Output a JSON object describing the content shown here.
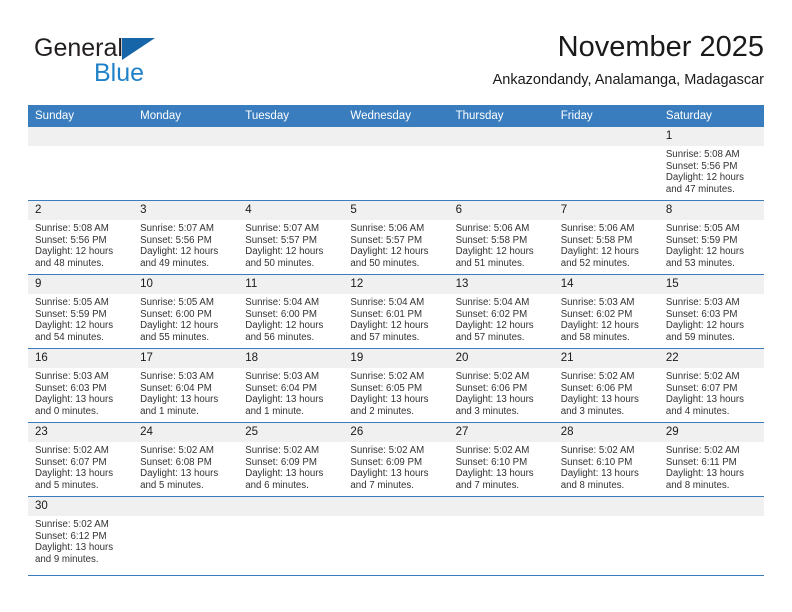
{
  "brand": {
    "name_top": "General",
    "name_bottom": "Blue",
    "color_black": "#231f20",
    "color_blue": "#1f82c8",
    "triangle_color": "#1565a8"
  },
  "header": {
    "title": "November 2025",
    "subtitle": "Ankazondandy, Analamanga, Madagascar"
  },
  "theme": {
    "header_bg": "#3a7dbf",
    "header_text": "#ffffff",
    "daynum_bg": "#f0f0f0",
    "row_line": "#3a7dbf"
  },
  "weekdays": [
    "Sunday",
    "Monday",
    "Tuesday",
    "Wednesday",
    "Thursday",
    "Friday",
    "Saturday"
  ],
  "weeks": [
    [
      {
        "day": "",
        "empty": true
      },
      {
        "day": "",
        "empty": true
      },
      {
        "day": "",
        "empty": true
      },
      {
        "day": "",
        "empty": true
      },
      {
        "day": "",
        "empty": true
      },
      {
        "day": "",
        "empty": true
      },
      {
        "day": "1",
        "sunrise": "Sunrise: 5:08 AM",
        "sunset": "Sunset: 5:56 PM",
        "daylight": "Daylight: 12 hours and 47 minutes."
      }
    ],
    [
      {
        "day": "2",
        "sunrise": "Sunrise: 5:08 AM",
        "sunset": "Sunset: 5:56 PM",
        "daylight": "Daylight: 12 hours and 48 minutes."
      },
      {
        "day": "3",
        "sunrise": "Sunrise: 5:07 AM",
        "sunset": "Sunset: 5:56 PM",
        "daylight": "Daylight: 12 hours and 49 minutes."
      },
      {
        "day": "4",
        "sunrise": "Sunrise: 5:07 AM",
        "sunset": "Sunset: 5:57 PM",
        "daylight": "Daylight: 12 hours and 50 minutes."
      },
      {
        "day": "5",
        "sunrise": "Sunrise: 5:06 AM",
        "sunset": "Sunset: 5:57 PM",
        "daylight": "Daylight: 12 hours and 50 minutes."
      },
      {
        "day": "6",
        "sunrise": "Sunrise: 5:06 AM",
        "sunset": "Sunset: 5:58 PM",
        "daylight": "Daylight: 12 hours and 51 minutes."
      },
      {
        "day": "7",
        "sunrise": "Sunrise: 5:06 AM",
        "sunset": "Sunset: 5:58 PM",
        "daylight": "Daylight: 12 hours and 52 minutes."
      },
      {
        "day": "8",
        "sunrise": "Sunrise: 5:05 AM",
        "sunset": "Sunset: 5:59 PM",
        "daylight": "Daylight: 12 hours and 53 minutes."
      }
    ],
    [
      {
        "day": "9",
        "sunrise": "Sunrise: 5:05 AM",
        "sunset": "Sunset: 5:59 PM",
        "daylight": "Daylight: 12 hours and 54 minutes."
      },
      {
        "day": "10",
        "sunrise": "Sunrise: 5:05 AM",
        "sunset": "Sunset: 6:00 PM",
        "daylight": "Daylight: 12 hours and 55 minutes."
      },
      {
        "day": "11",
        "sunrise": "Sunrise: 5:04 AM",
        "sunset": "Sunset: 6:00 PM",
        "daylight": "Daylight: 12 hours and 56 minutes."
      },
      {
        "day": "12",
        "sunrise": "Sunrise: 5:04 AM",
        "sunset": "Sunset: 6:01 PM",
        "daylight": "Daylight: 12 hours and 57 minutes."
      },
      {
        "day": "13",
        "sunrise": "Sunrise: 5:04 AM",
        "sunset": "Sunset: 6:02 PM",
        "daylight": "Daylight: 12 hours and 57 minutes."
      },
      {
        "day": "14",
        "sunrise": "Sunrise: 5:03 AM",
        "sunset": "Sunset: 6:02 PM",
        "daylight": "Daylight: 12 hours and 58 minutes."
      },
      {
        "day": "15",
        "sunrise": "Sunrise: 5:03 AM",
        "sunset": "Sunset: 6:03 PM",
        "daylight": "Daylight: 12 hours and 59 minutes."
      }
    ],
    [
      {
        "day": "16",
        "sunrise": "Sunrise: 5:03 AM",
        "sunset": "Sunset: 6:03 PM",
        "daylight": "Daylight: 13 hours and 0 minutes."
      },
      {
        "day": "17",
        "sunrise": "Sunrise: 5:03 AM",
        "sunset": "Sunset: 6:04 PM",
        "daylight": "Daylight: 13 hours and 1 minute."
      },
      {
        "day": "18",
        "sunrise": "Sunrise: 5:03 AM",
        "sunset": "Sunset: 6:04 PM",
        "daylight": "Daylight: 13 hours and 1 minute."
      },
      {
        "day": "19",
        "sunrise": "Sunrise: 5:02 AM",
        "sunset": "Sunset: 6:05 PM",
        "daylight": "Daylight: 13 hours and 2 minutes."
      },
      {
        "day": "20",
        "sunrise": "Sunrise: 5:02 AM",
        "sunset": "Sunset: 6:06 PM",
        "daylight": "Daylight: 13 hours and 3 minutes."
      },
      {
        "day": "21",
        "sunrise": "Sunrise: 5:02 AM",
        "sunset": "Sunset: 6:06 PM",
        "daylight": "Daylight: 13 hours and 3 minutes."
      },
      {
        "day": "22",
        "sunrise": "Sunrise: 5:02 AM",
        "sunset": "Sunset: 6:07 PM",
        "daylight": "Daylight: 13 hours and 4 minutes."
      }
    ],
    [
      {
        "day": "23",
        "sunrise": "Sunrise: 5:02 AM",
        "sunset": "Sunset: 6:07 PM",
        "daylight": "Daylight: 13 hours and 5 minutes."
      },
      {
        "day": "24",
        "sunrise": "Sunrise: 5:02 AM",
        "sunset": "Sunset: 6:08 PM",
        "daylight": "Daylight: 13 hours and 5 minutes."
      },
      {
        "day": "25",
        "sunrise": "Sunrise: 5:02 AM",
        "sunset": "Sunset: 6:09 PM",
        "daylight": "Daylight: 13 hours and 6 minutes."
      },
      {
        "day": "26",
        "sunrise": "Sunrise: 5:02 AM",
        "sunset": "Sunset: 6:09 PM",
        "daylight": "Daylight: 13 hours and 7 minutes."
      },
      {
        "day": "27",
        "sunrise": "Sunrise: 5:02 AM",
        "sunset": "Sunset: 6:10 PM",
        "daylight": "Daylight: 13 hours and 7 minutes."
      },
      {
        "day": "28",
        "sunrise": "Sunrise: 5:02 AM",
        "sunset": "Sunset: 6:10 PM",
        "daylight": "Daylight: 13 hours and 8 minutes."
      },
      {
        "day": "29",
        "sunrise": "Sunrise: 5:02 AM",
        "sunset": "Sunset: 6:11 PM",
        "daylight": "Daylight: 13 hours and 8 minutes."
      }
    ],
    [
      {
        "day": "30",
        "sunrise": "Sunrise: 5:02 AM",
        "sunset": "Sunset: 6:12 PM",
        "daylight": "Daylight: 13 hours and 9 minutes."
      },
      {
        "day": "",
        "empty": true
      },
      {
        "day": "",
        "empty": true
      },
      {
        "day": "",
        "empty": true
      },
      {
        "day": "",
        "empty": true
      },
      {
        "day": "",
        "empty": true
      },
      {
        "day": "",
        "empty": true
      }
    ]
  ]
}
